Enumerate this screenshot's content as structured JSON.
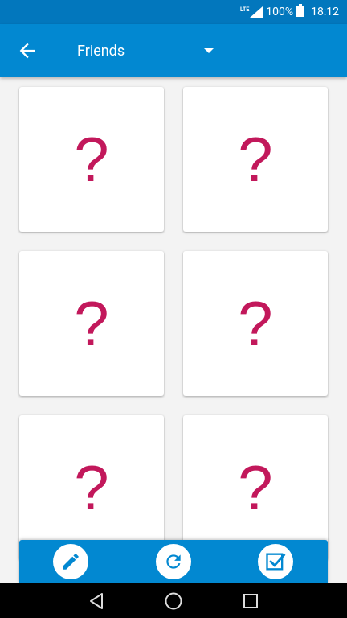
{
  "status_bar": {
    "network": "LTE",
    "battery": "100%",
    "time": "18:12"
  },
  "app_bar": {
    "title": "Friends"
  },
  "cards": [
    {
      "symbol": "?"
    },
    {
      "symbol": "?"
    },
    {
      "symbol": "?"
    },
    {
      "symbol": "?"
    },
    {
      "symbol": "?"
    },
    {
      "symbol": "?"
    }
  ],
  "bottom_actions": [
    "edit-icon",
    "refresh-icon",
    "checkbox-icon"
  ],
  "nav": [
    "back",
    "home",
    "recents"
  ],
  "colors": {
    "primary": "#0288d1",
    "primary_dark": "#0277bd",
    "accent": "#c2185b",
    "background": "#f3f3f3"
  }
}
